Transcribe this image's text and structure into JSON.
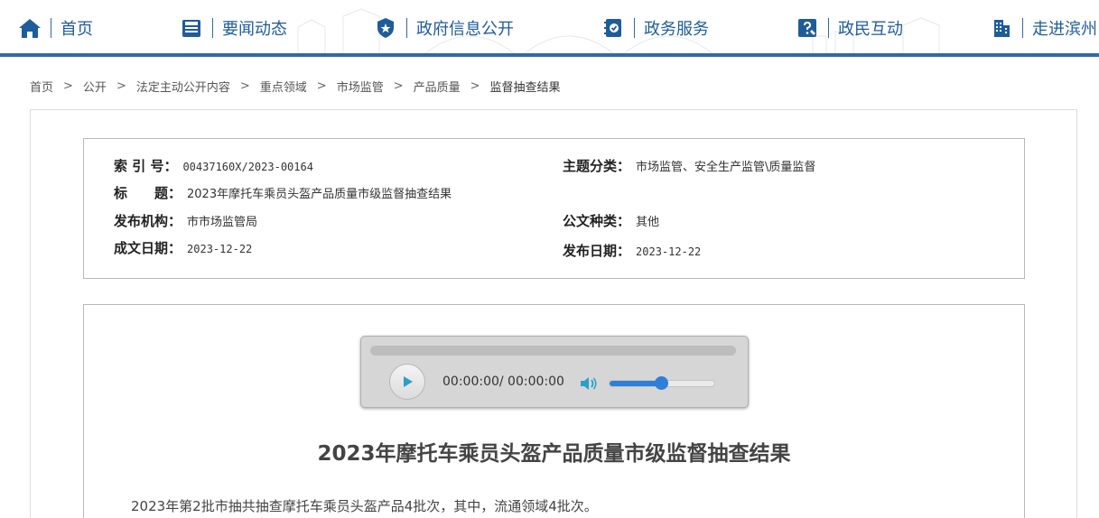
{
  "nav": {
    "items": [
      {
        "label": "首页",
        "icon": "home-icon"
      },
      {
        "label": "要闻动态",
        "icon": "news-icon"
      },
      {
        "label": "政府信息公开",
        "icon": "police-badge-icon"
      },
      {
        "label": "政务服务",
        "icon": "service-icon"
      },
      {
        "label": "政民互动",
        "icon": "interaction-icon"
      },
      {
        "label": "走进滨州",
        "icon": "building-icon"
      }
    ],
    "accent_color": "#2f6aa5"
  },
  "breadcrumb": [
    "首页",
    "公开",
    "法定主动公开内容",
    "重点领域",
    "市场监管",
    "产品质量",
    "监督抽查结果"
  ],
  "breadcrumb_separator": ">",
  "meta": {
    "index_key": "索 引 号：",
    "index_val": "00437160X/2023-00164",
    "topic_key": "主题分类：",
    "topic_val": "市场监管、安全生产监管\\质量监督",
    "title_key": "标　　题：",
    "title_val": "2023年摩托车乘员头盔产品质量市级监督抽查结果",
    "org_key": "发布机构：",
    "org_val": "市市场监管局",
    "doctype_key": "公文种类：",
    "doctype_val": "其他",
    "created_key": "成文日期：",
    "created_val": "2023-12-22",
    "published_key": "发布日期：",
    "published_val": "2023-12-22"
  },
  "player": {
    "time_text": "00:00:00/ 00:00:00",
    "progress": 0,
    "volume": 0.5,
    "accent_color": "#2d7fd8"
  },
  "article": {
    "title": "2023年摩托车乘员头盔产品质量市级监督抽查结果",
    "paragraph": "2023年第2批市抽共抽查摩托车乘员头盔产品4批次，其中，流通领域4批次。"
  }
}
